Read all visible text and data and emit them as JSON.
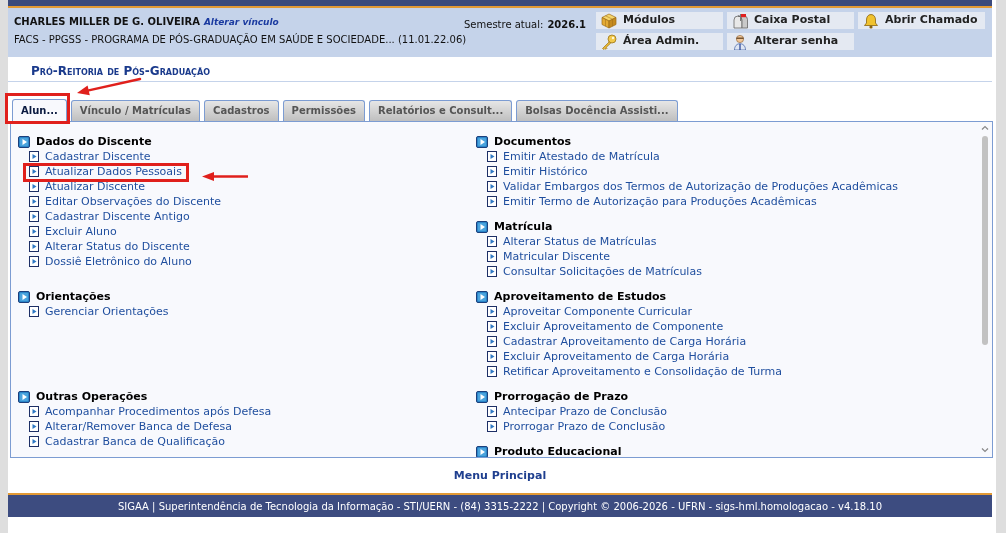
{
  "header": {
    "user_name": "CHARLES MILLER DE G. OLIVEIRA",
    "switch_link": "Alterar vínculo",
    "unit": "FACS - PPGSS - PROGRAMA DE PÓS-GRADUAÇÃO EM SAÚDE E SOCIEDADE... (11.01.22.06)",
    "semester_label": "Semestre atual:",
    "semester": "2026.1",
    "shortcuts": [
      {
        "label": "Módulos",
        "kind": "modules"
      },
      {
        "label": "Caixa Postal",
        "kind": "mail"
      },
      {
        "label": "Abrir Chamado",
        "kind": "bell"
      },
      {
        "label": "Área Admin.",
        "kind": "key"
      },
      {
        "label": "Alterar senha",
        "kind": "user"
      }
    ]
  },
  "title": "Pró-Reitoria de Pós-Graduação",
  "tabs": [
    {
      "label": "Alun...",
      "selected": true,
      "callout": true
    },
    {
      "label": "Vínculo / Matrículas",
      "selected": false,
      "callout": false
    },
    {
      "label": "Cadastros",
      "selected": false,
      "callout": false
    },
    {
      "label": "Permissões",
      "selected": false,
      "callout": false
    },
    {
      "label": "Relatórios e Consult...",
      "selected": false,
      "callout": false
    },
    {
      "label": "Bolsas Docência Assisti...",
      "selected": false,
      "callout": false
    }
  ],
  "tab_panel": {
    "rows": [
      {
        "cells": [
          {
            "sections": [
              {
                "title": "Dados do Discente",
                "items": [
                  {
                    "label": "Cadastrar Discente",
                    "callout": false
                  },
                  {
                    "label": "Atualizar Dados Pessoais",
                    "callout": true
                  },
                  {
                    "label": "Atualizar Discente",
                    "callout": false
                  },
                  {
                    "label": "Editar Observações do Discente",
                    "callout": false
                  },
                  {
                    "label": "Cadastrar Discente Antigo",
                    "callout": false
                  },
                  {
                    "label": "Excluir Aluno",
                    "callout": false
                  },
                  {
                    "label": "Alterar Status do Discente",
                    "callout": false
                  },
                  {
                    "label": "Dossiê Eletrônico do Aluno",
                    "callout": false
                  }
                ]
              }
            ]
          },
          {
            "sections": [
              {
                "title": "Documentos",
                "items": [
                  {
                    "label": "Emitir Atestado de Matrícula",
                    "callout": false
                  },
                  {
                    "label": "Emitir Histórico",
                    "callout": false
                  },
                  {
                    "label": "Validar Embargos dos Termos de Autorização de Produções Acadêmicas",
                    "callout": false
                  },
                  {
                    "label": "Emitir Termo de Autorização para Produções Acadêmicas",
                    "callout": false
                  }
                ]
              },
              {
                "title": "Matrícula",
                "items": [
                  {
                    "label": "Alterar Status de Matrículas",
                    "callout": false
                  },
                  {
                    "label": "Matricular Discente",
                    "callout": false
                  },
                  {
                    "label": "Consultar Solicitações de Matrículas",
                    "callout": false
                  }
                ]
              }
            ]
          }
        ]
      },
      {
        "cells": [
          {
            "sections": [
              {
                "title": "Orientações",
                "items": [
                  {
                    "label": "Gerenciar Orientações",
                    "callout": false
                  }
                ]
              }
            ]
          },
          {
            "sections": [
              {
                "title": "Aproveitamento de Estudos",
                "items": [
                  {
                    "label": "Aproveitar Componente Curricular",
                    "callout": false
                  },
                  {
                    "label": "Excluir Aproveitamento de Componente",
                    "callout": false
                  },
                  {
                    "label": "Cadastrar Aproveitamento de Carga Horária",
                    "callout": false
                  },
                  {
                    "label": "Excluir Aproveitamento de Carga Horária",
                    "callout": false
                  },
                  {
                    "label": "Retificar Aproveitamento e Consolidação de Turma",
                    "callout": false
                  }
                ]
              }
            ]
          }
        ]
      },
      {
        "cells": [
          {
            "sections": [
              {
                "title": "Outras Operações",
                "items": [
                  {
                    "label": "Acompanhar Procedimentos após Defesa",
                    "callout": false
                  },
                  {
                    "label": "Alterar/Remover Banca de Defesa",
                    "callout": false
                  },
                  {
                    "label": "Cadastrar Banca de Qualificação",
                    "callout": false
                  }
                ]
              }
            ]
          },
          {
            "sections": [
              {
                "title": "Prorrogação de Prazo",
                "items": [
                  {
                    "label": "Antecipar Prazo de Conclusão",
                    "callout": false
                  },
                  {
                    "label": "Prorrogar Prazo de Conclusão",
                    "callout": false
                  }
                ]
              },
              {
                "title": "Produto Educacional"
              }
            ]
          }
        ]
      }
    ]
  },
  "main_menu_link": "Menu Principal",
  "footer": "SIGAA | Superintendência de Tecnologia da Informação - STI/UERN - (84) 3315-2222 | Copyright © 2006-2026 - UFRN - sigs-hml.homologacao - v4.18.10"
}
